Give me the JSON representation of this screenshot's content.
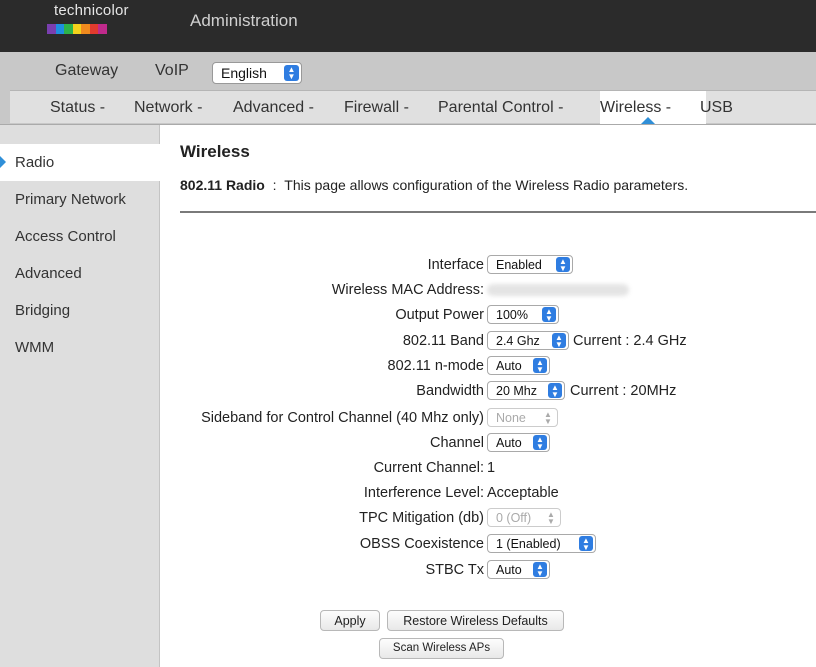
{
  "brand": {
    "name": "technicolor",
    "stripe_colors": [
      "#7a3fb0",
      "#1e8fe0",
      "#2db34a",
      "#f3d21c",
      "#f08a1e",
      "#e23b2e",
      "#c02a8c"
    ]
  },
  "header": {
    "title": "Administration"
  },
  "nav_top": {
    "items": [
      "Gateway",
      "VoIP"
    ],
    "language": {
      "selected": "English"
    }
  },
  "tabs": [
    {
      "label": "Status -"
    },
    {
      "label": "Network -"
    },
    {
      "label": "Advanced -"
    },
    {
      "label": "Firewall -"
    },
    {
      "label": "Parental Control -"
    },
    {
      "label": "Wireless -",
      "active": true
    },
    {
      "label": "USB"
    }
  ],
  "sidebar": {
    "items": [
      {
        "label": "Radio",
        "active": true
      },
      {
        "label": "Primary Network"
      },
      {
        "label": "Access Control"
      },
      {
        "label": "Advanced"
      },
      {
        "label": "Bridging"
      },
      {
        "label": "WMM"
      }
    ]
  },
  "page": {
    "title": "Wireless",
    "desc_bold": "802.11 Radio",
    "desc_sep": ":",
    "desc_text": "This page allows configuration of the Wireless Radio parameters."
  },
  "form": {
    "interface": {
      "label": "Interface",
      "value": "Enabled"
    },
    "mac": {
      "label": "Wireless MAC Address:"
    },
    "output_power": {
      "label": "Output Power",
      "value": "100%"
    },
    "band": {
      "label": "802.11 Band",
      "value": "2.4 Ghz",
      "current": "Current :  2.4 GHz"
    },
    "nmode": {
      "label": "802.11 n-mode",
      "value": "Auto"
    },
    "bandwidth": {
      "label": "Bandwidth",
      "value": "20 Mhz",
      "current": "Current :  20MHz"
    },
    "sideband": {
      "label": "Sideband for Control Channel (40 Mhz only)",
      "value": "None"
    },
    "channel": {
      "label": "Channel",
      "value": "Auto"
    },
    "current_channel": {
      "label": "Current Channel:",
      "value": "1"
    },
    "interference": {
      "label": "Interference Level:",
      "value": "Acceptable"
    },
    "tpc": {
      "label": "TPC Mitigation (db)",
      "value": "0 (Off)"
    },
    "obss": {
      "label": "OBSS Coexistence",
      "value": "1 (Enabled)"
    },
    "stbc": {
      "label": "STBC Tx",
      "value": "Auto"
    }
  },
  "buttons": {
    "apply": "Apply",
    "restore": "Restore Wireless Defaults",
    "scan": "Scan Wireless APs"
  },
  "colors": {
    "accent": "#2f8fd8",
    "select_arrow": "#2f7de1"
  }
}
